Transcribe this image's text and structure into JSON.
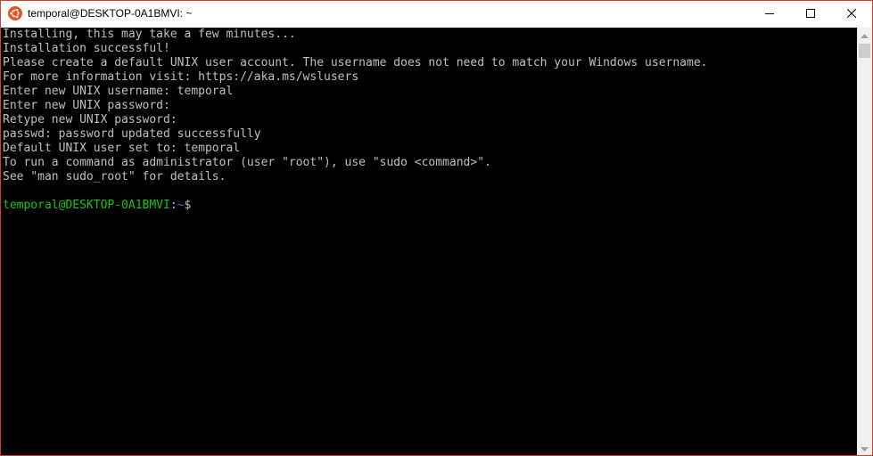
{
  "window": {
    "title": "temporal@DESKTOP-0A1BMVI: ~",
    "app_icon": "ubuntu-icon",
    "controls": [
      "minimize-icon",
      "maximize-icon",
      "close-icon"
    ],
    "border_color": "#d93a2a"
  },
  "terminal": {
    "background": "#000000",
    "text_color": "#c0c0c0",
    "lines": [
      "Installing, this may take a few minutes...",
      "Installation successful!",
      "Please create a default UNIX user account. The username does not need to match your Windows username.",
      "For more information visit: https://aka.ms/wslusers",
      "Enter new UNIX username: temporal",
      "Enter new UNIX password:",
      "Retype new UNIX password:",
      "passwd: password updated successfully",
      "Default UNIX user set to: temporal",
      "To run a command as administrator (user \"root\"), use \"sudo <command>\".",
      "See \"man sudo_root\" for details.",
      ""
    ],
    "prompt": {
      "user_host": "temporal@DESKTOP-0A1BMVI",
      "separator": ":",
      "path": "~",
      "symbol": "$",
      "user_color": "#16c60c",
      "path_color": "#3b78ff"
    }
  }
}
